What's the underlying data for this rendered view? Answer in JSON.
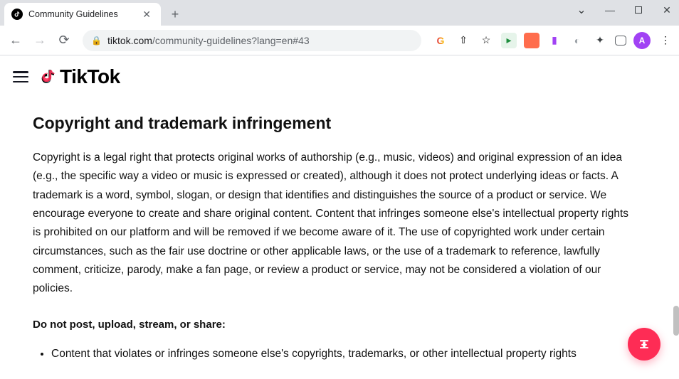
{
  "browser": {
    "tab": {
      "title": "Community Guidelines"
    },
    "url_host": "tiktok.com",
    "url_path": "/community-guidelines?lang=en#43",
    "avatar_initial": "A"
  },
  "page": {
    "brand": "TikTok",
    "heading": "Copyright and trademark infringement",
    "paragraph": "Copyright is a legal right that protects original works of authorship (e.g., music, videos) and original expression of an idea (e.g., the specific way a video or music is expressed or created), although it does not protect underlying ideas or facts. A trademark is a word, symbol, slogan, or design that identifies and distinguishes the source of a product or service. We encourage everyone to create and share original content. Content that infringes someone else's intellectual property rights is prohibited on our platform and will be removed if we become aware of it. The use of copyrighted work under certain circumstances, such as the fair use doctrine or other applicable laws, or the use of a trademark to reference, lawfully comment, criticize, parody, make a fan page, or review a product or service, may not be considered a violation of our policies.",
    "lead": "Do not post, upload, stream, or share:",
    "bullets": [
      "Content that violates or infringes someone else's copyrights, trademarks, or other intellectual property rights"
    ]
  }
}
